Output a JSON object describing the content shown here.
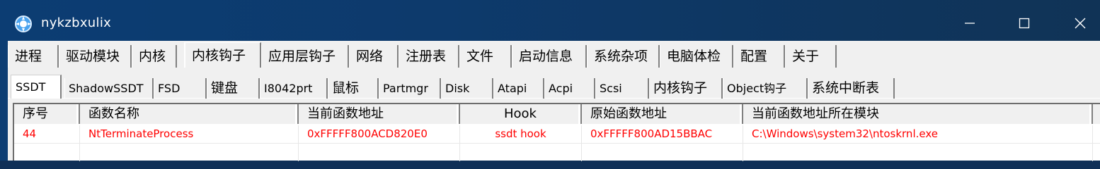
{
  "window": {
    "title": "nykzbxulix",
    "icon": "app-globe-icon",
    "controls": {
      "minimize": "—",
      "maximize": "☐",
      "close": "✕"
    }
  },
  "tabs_main": [
    {
      "label": "进程"
    },
    {
      "label": "驱动模块"
    },
    {
      "label": "内核"
    },
    {
      "label": "内核钩子",
      "active": true
    },
    {
      "label": "应用层钩子"
    },
    {
      "label": "网络"
    },
    {
      "label": "注册表"
    },
    {
      "label": "文件"
    },
    {
      "label": "启动信息"
    },
    {
      "label": "系统杂项"
    },
    {
      "label": "电脑体检"
    },
    {
      "label": "配置"
    },
    {
      "label": "关于"
    }
  ],
  "tabs_sub": [
    {
      "label": "SSDT",
      "active": true
    },
    {
      "label": "ShadowSSDT"
    },
    {
      "label": "FSD"
    },
    {
      "label": "键盘"
    },
    {
      "label": "I8042prt"
    },
    {
      "label": "鼠标"
    },
    {
      "label": "Partmgr"
    },
    {
      "label": "Disk"
    },
    {
      "label": "Atapi"
    },
    {
      "label": "Acpi"
    },
    {
      "label": "Scsi"
    },
    {
      "label": "内核钩子"
    },
    {
      "label": "Object钩子"
    },
    {
      "label": "系统中断表"
    }
  ],
  "table": {
    "columns": [
      "序号",
      "函数名称",
      "当前函数地址",
      "Hook",
      "原始函数地址",
      "当前函数地址所在模块"
    ],
    "rows": [
      [
        "44",
        "NtTerminateProcess",
        "0xFFFFF800ACD820E0",
        "ssdt hook",
        "0xFFFFF800AD15BBAC",
        "C:\\Windows\\system32\\ntoskrnl.exe"
      ]
    ],
    "row_color": "#ff0000"
  },
  "colors": {
    "titlebar": "#0c3d73",
    "client": "#f0f0f0",
    "hook_text": "#ff0000"
  }
}
